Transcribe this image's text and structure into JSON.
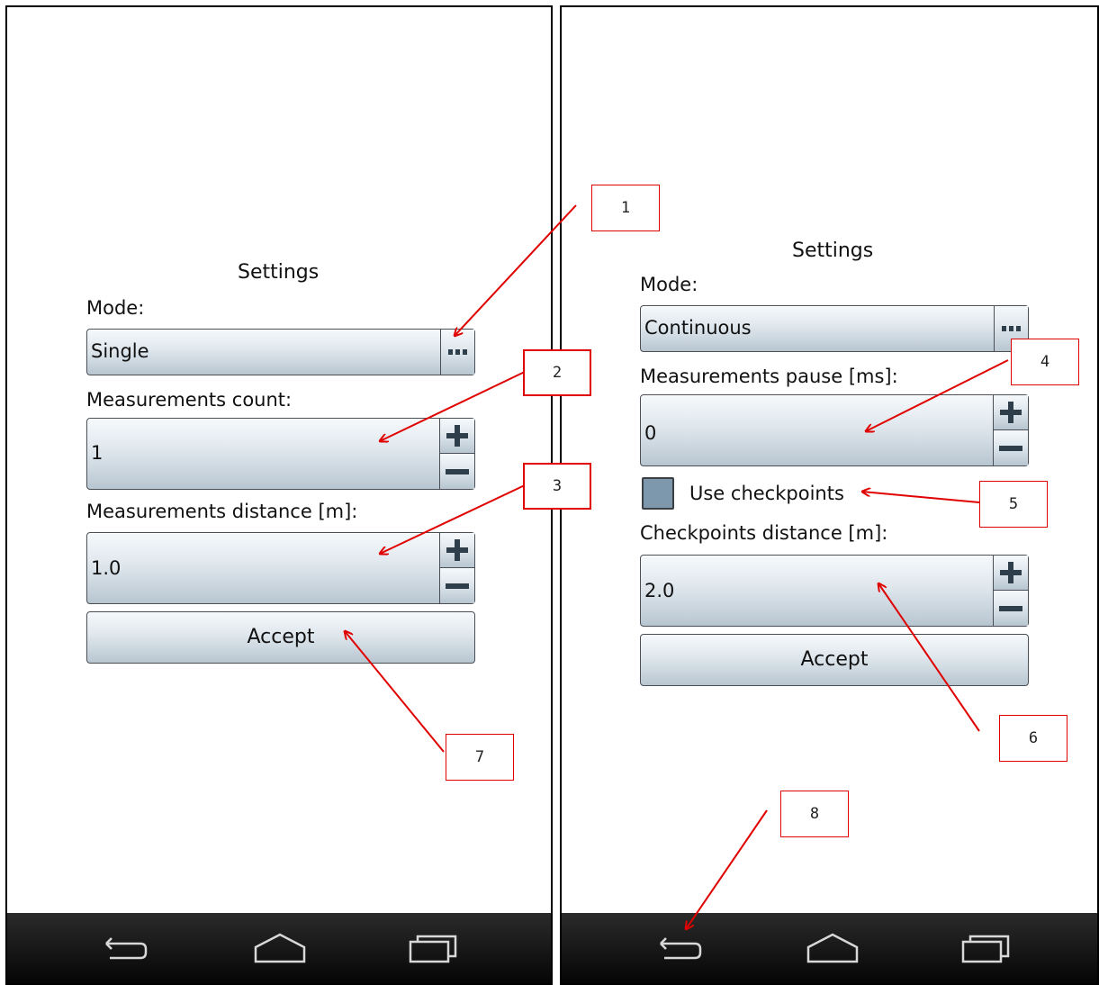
{
  "left_screen": {
    "title": "Settings",
    "mode_label": "Mode:",
    "mode_value": "Single",
    "count_label": "Measurements count:",
    "count_value": "1",
    "distance_label": "Measurements distance [m]:",
    "distance_value": "1.0",
    "accept_label": "Accept"
  },
  "right_screen": {
    "title": "Settings",
    "mode_label": "Mode:",
    "mode_value": "Continuous",
    "pause_label": "Measurements pause [ms]:",
    "pause_value": "0",
    "checkpoints_checkbox_label": "Use checkpoints",
    "checkpoints_distance_label": "Checkpoints distance [m]:",
    "checkpoints_distance_value": "2.0",
    "accept_label": "Accept"
  },
  "callouts": [
    "1",
    "2",
    "3",
    "4",
    "5",
    "6",
    "7",
    "8"
  ],
  "navbar_icons": [
    "back-icon",
    "home-icon",
    "recent-apps-icon"
  ],
  "colors": {
    "arrow": "#e00000",
    "checkbox_fill": "#7d98ad",
    "navbar": "#111111"
  }
}
